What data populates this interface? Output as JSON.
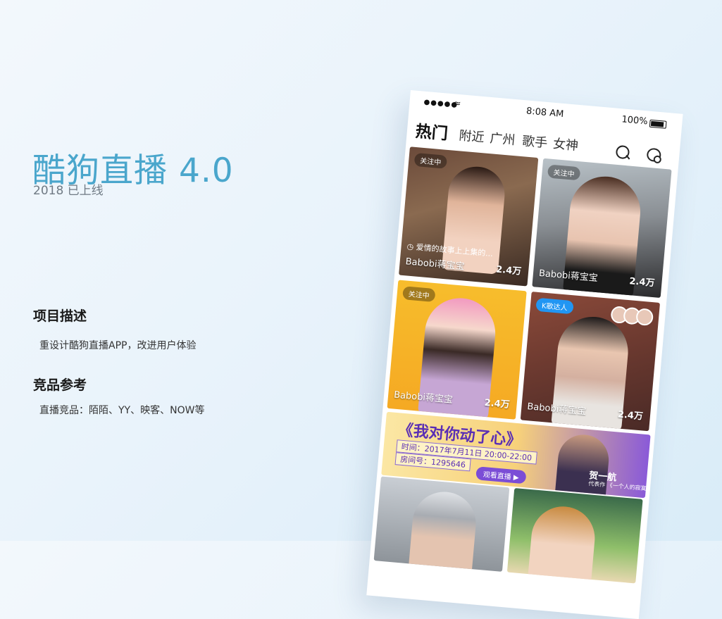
{
  "intro": {
    "title": "酷狗直播 4.0",
    "subtitle": "2018 已上线"
  },
  "sections": [
    {
      "heading": "项目描述",
      "body": "重设计酷狗直播APP，改进用户体验"
    },
    {
      "heading": "竞品参考",
      "body": "直播竞品：陌陌、YY、映客、NOW等"
    }
  ],
  "phone": {
    "status": {
      "time": "8:08 AM",
      "battery": "100%"
    },
    "tabs": [
      "热门",
      "附近",
      "广州",
      "歌手",
      "女神"
    ],
    "cards": [
      {
        "badge": "关注中",
        "song": "爱情的故事上上集的...",
        "name": "Babobi蒋宝宝",
        "count": "2.4万"
      },
      {
        "badge": "关注中",
        "name": "Babobi蒋宝宝",
        "count": "2.4万"
      },
      {
        "badge": "关注中",
        "name": "Babobi蒋宝宝",
        "count": "2.4万"
      },
      {
        "badge": "K歌达人",
        "name": "Babobi蒋宝宝",
        "count": "2.4万"
      }
    ],
    "banner": {
      "title": "《我对你动了心》",
      "time": "时间：2017年7月11日 20:00-22:00",
      "room": "房间号：1295646",
      "button": "观看直播",
      "person": "贺一航",
      "rep_label": "代表作",
      "rep_work": "《一个人的寂寞两个人的错》"
    }
  }
}
